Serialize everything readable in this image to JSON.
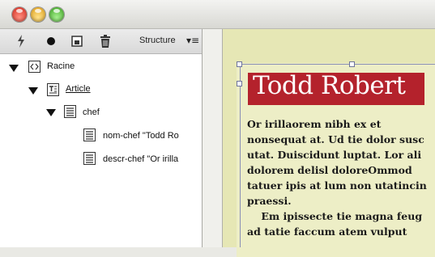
{
  "toolbar": {
    "icons": [
      "lightning-icon",
      "circle-icon",
      "frame-icon",
      "trash-icon"
    ],
    "structure_label": "Structure",
    "menu_glyph": "▾≡"
  },
  "tree": {
    "root": "Racine",
    "article": "Article",
    "chef": "chef",
    "leaf1": "nom-chef  \"Todd Ro",
    "leaf2": "descr-chef  \"Or irilla"
  },
  "document": {
    "title": "Todd Robert",
    "lines": [
      "Or irillaorem nibh ex et",
      "nonsequat at. Ud tie dolor susc",
      "utat. Duiscidunt luptat. Lor ali",
      "dolorem delisl doloreOmmod",
      "tatuer ipis at lum non utatincin",
      "praessi.",
      "    Em ipissecte tie magna feug",
      "ad tatie faccum atem vulput"
    ]
  },
  "colors": {
    "title_bg": "#b4222c",
    "canvas_bg": "#e6e7b5"
  }
}
